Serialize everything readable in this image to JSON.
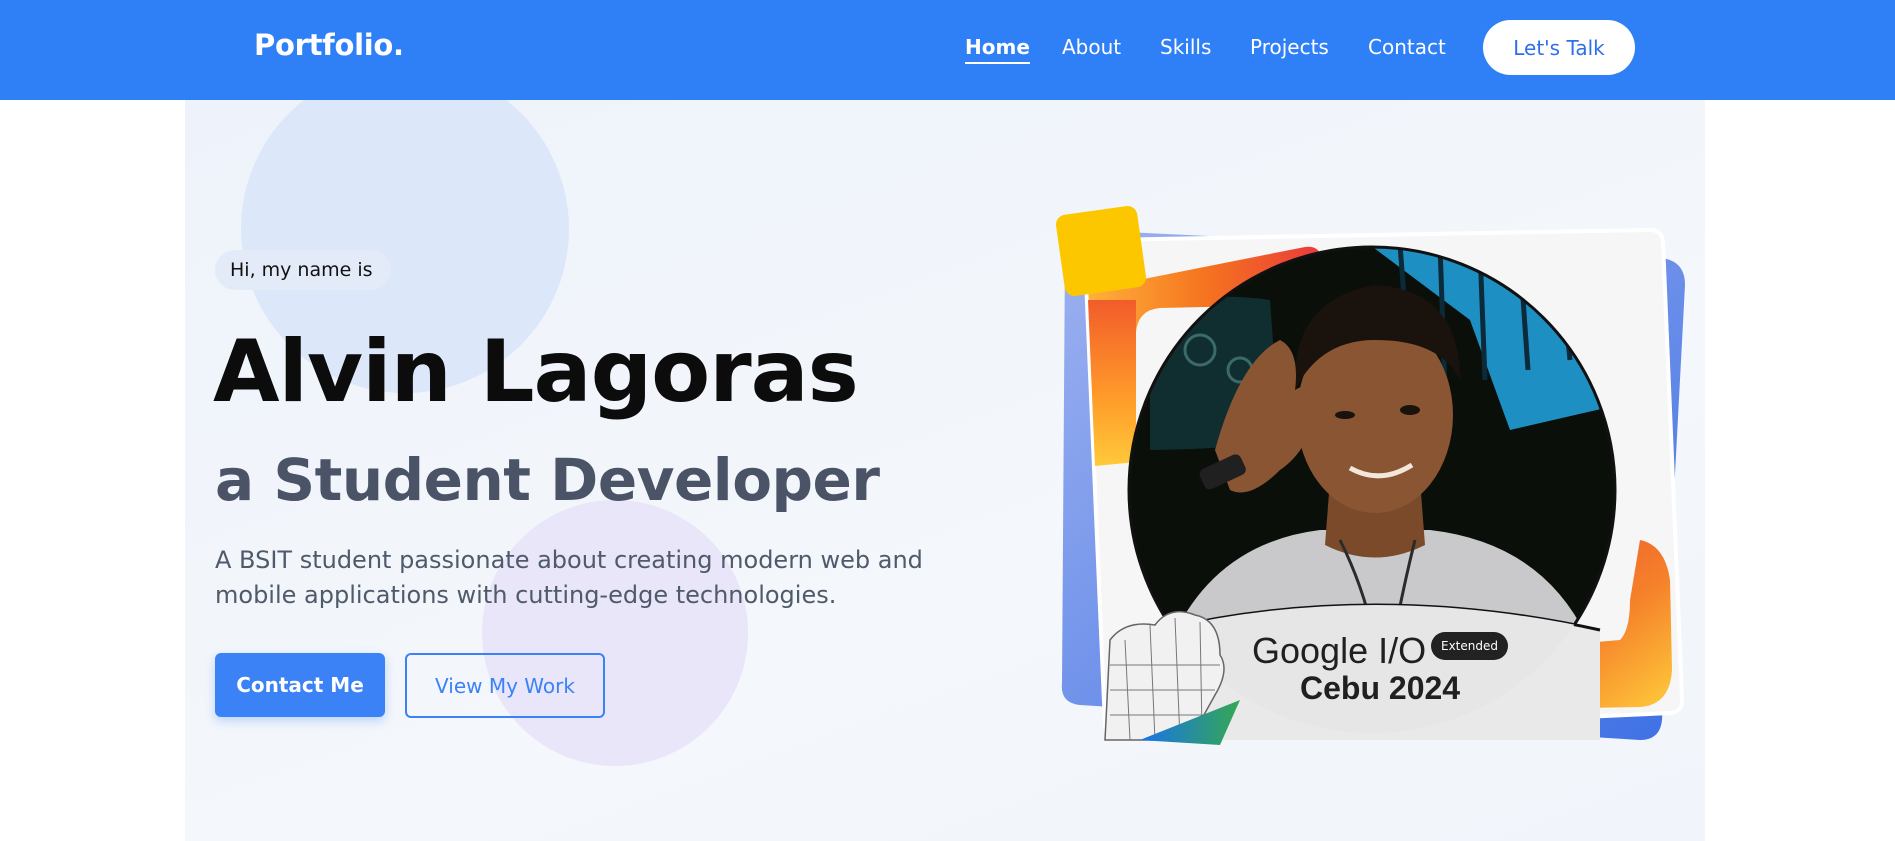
{
  "nav": {
    "logo": "Portfolio.",
    "links": [
      "Home",
      "About",
      "Skills",
      "Projects",
      "Contact"
    ],
    "active": "Home",
    "cta": "Let's Talk"
  },
  "hero": {
    "greeting": "Hi, my name is",
    "name": "Alvin Lagoras",
    "role": "a Student Developer",
    "description": "A BSIT student passionate about creating modern web and mobile applications with cutting-edge technologies.",
    "primary_button": "Contact Me",
    "secondary_button": "View My Work"
  },
  "photo": {
    "event_title": "Google I/O",
    "event_badge": "Extended",
    "event_subtitle": "Cebu 2024"
  },
  "colors": {
    "nav_bg": "#2f80f7",
    "accent": "#3b82f6",
    "heading": "#0c0c0c",
    "subheading": "#4a5466",
    "text": "#4f5a6b",
    "hero_bg": "#f1f5fb",
    "yellow_accent": "#fdc700"
  }
}
